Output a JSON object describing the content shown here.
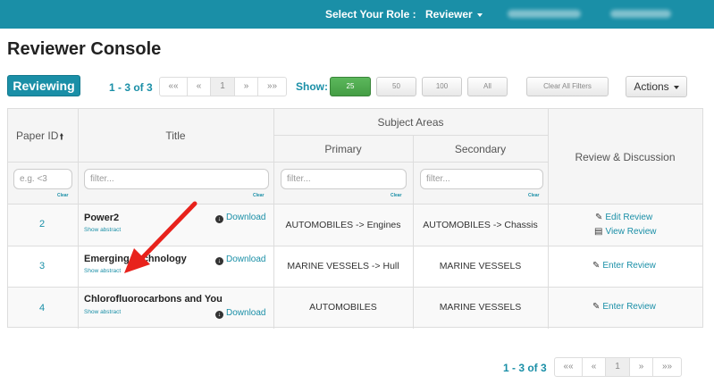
{
  "topbar": {
    "role_label": "Select Your Role :",
    "role_value": "Reviewer"
  },
  "page_title": "Reviewer Console",
  "badge": "Reviewing",
  "pagination": {
    "count": "1 - 3 of 3",
    "first": "««",
    "prev": "«",
    "page": "1",
    "next": "»",
    "last": "»»"
  },
  "show": {
    "label": "Show:",
    "options": [
      "25",
      "50",
      "100",
      "All"
    ],
    "selected": "25"
  },
  "toolbar": {
    "clear_filters": "Clear All Filters",
    "actions": "Actions"
  },
  "table": {
    "headers": {
      "paper_id": "Paper ID",
      "title": "Title",
      "subject_areas": "Subject Areas",
      "primary": "Primary",
      "secondary": "Secondary",
      "review": "Review & Discussion"
    },
    "filters": {
      "paper_id_placeholder": "e.g. <3",
      "title_placeholder": "filter...",
      "primary_placeholder": "filter...",
      "secondary_placeholder": "filter...",
      "clear": "Clear"
    },
    "show_abstract": "Show abstract",
    "download": "Download",
    "rows": [
      {
        "id": "2",
        "title": "Power2",
        "primary": "AUTOMOBILES -> Engines",
        "secondary": "AUTOMOBILES -> Chassis",
        "actions": [
          "Edit Review",
          "View Review"
        ]
      },
      {
        "id": "3",
        "title": "Emerging Technology",
        "primary": "MARINE VESSELS -> Hull",
        "secondary": "MARINE VESSELS",
        "actions": [
          "Enter Review"
        ]
      },
      {
        "id": "4",
        "title": "Chlorofluorocarbons and You",
        "primary": "AUTOMOBILES",
        "secondary": "MARINE VESSELS",
        "actions": [
          "Enter Review"
        ]
      }
    ]
  },
  "colors": {
    "brand": "#1a8fa7",
    "selected": "#5cb85c",
    "annotation_arrow": "#e8221c"
  },
  "icons": {
    "sort": "sort-up-arrow-icon",
    "download": "download-icon",
    "edit": "edit-icon",
    "view": "document-icon"
  }
}
